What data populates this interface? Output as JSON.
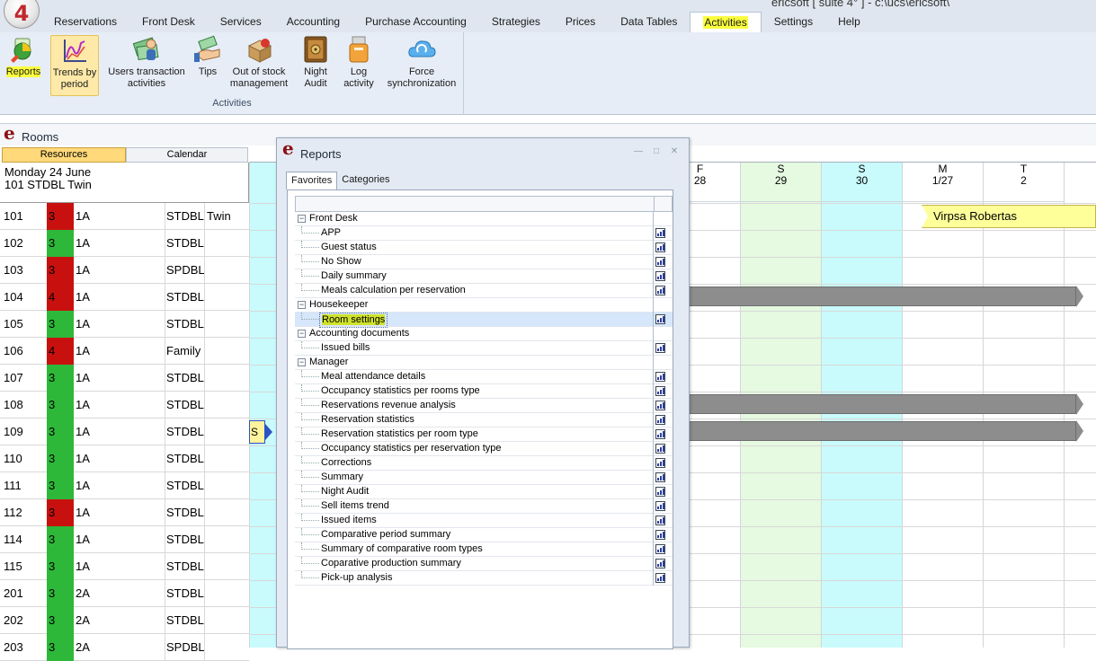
{
  "window": {
    "title": "ericsoft [ suite 4° ] - c:\\ucs\\ericsoft\\",
    "logo_text": "4"
  },
  "menu": {
    "tabs": [
      "Reservations",
      "Front Desk",
      "Services",
      "Accounting",
      "Purchase Accounting",
      "Strategies",
      "Prices",
      "Data Tables",
      "Activities",
      "Settings",
      "Help"
    ],
    "active": "Activities"
  },
  "ribbon": {
    "group_label": "Activities",
    "buttons": {
      "reports": {
        "line1": "Reports",
        "line2": "",
        "icon": "reports-icon"
      },
      "trends": {
        "line1": "Trends by",
        "line2": "period",
        "icon": "chart-icon"
      },
      "users_tx": {
        "line1": "Users transaction",
        "line2": "activities",
        "icon": "money-user-icon"
      },
      "tips": {
        "line1": "Tips",
        "line2": "",
        "icon": "tips-hand-icon"
      },
      "stock": {
        "line1": "Out of stock",
        "line2": "management",
        "icon": "boxes-icon"
      },
      "night_audit": {
        "line1": "Night",
        "line2": "Audit",
        "icon": "safe-icon"
      },
      "log": {
        "line1": "Log",
        "line2": "activity",
        "icon": "usb-icon"
      },
      "sync": {
        "line1": "Force",
        "line2": "synchronization",
        "icon": "cloud-icon"
      }
    }
  },
  "rooms_panel": {
    "title": "Rooms",
    "tabs": {
      "resources": "Resources",
      "calendar": "Calendar"
    },
    "selected_date": "Monday 24 June",
    "selected_room": "101 STDBL Twin",
    "rows": [
      {
        "num": "101",
        "status": "3",
        "color": "red",
        "cap": "1A",
        "type": "STDBL",
        "extra": "Twin"
      },
      {
        "num": "102",
        "status": "3",
        "color": "green",
        "cap": "1A",
        "type": "STDBL",
        "extra": ""
      },
      {
        "num": "103",
        "status": "3",
        "color": "red",
        "cap": "1A",
        "type": "SPDBL",
        "extra": ""
      },
      {
        "num": "104",
        "status": "4",
        "color": "red",
        "cap": "1A",
        "type": "STDBL",
        "extra": ""
      },
      {
        "num": "105",
        "status": "3",
        "color": "green",
        "cap": "1A",
        "type": "STDBL",
        "extra": ""
      },
      {
        "num": "106",
        "status": "4",
        "color": "red",
        "cap": "1A",
        "type": "Family",
        "extra": ""
      },
      {
        "num": "107",
        "status": "3",
        "color": "green",
        "cap": "1A",
        "type": "STDBL",
        "extra": ""
      },
      {
        "num": "108",
        "status": "3",
        "color": "green",
        "cap": "1A",
        "type": "STDBL",
        "extra": ""
      },
      {
        "num": "109",
        "status": "3",
        "color": "green",
        "cap": "1A",
        "type": "STDBL",
        "extra": ""
      },
      {
        "num": "110",
        "status": "3",
        "color": "green",
        "cap": "1A",
        "type": "STDBL",
        "extra": ""
      },
      {
        "num": "111",
        "status": "3",
        "color": "green",
        "cap": "1A",
        "type": "STDBL",
        "extra": ""
      },
      {
        "num": "112",
        "status": "3",
        "color": "red",
        "cap": "1A",
        "type": "STDBL",
        "extra": ""
      },
      {
        "num": "114",
        "status": "3",
        "color": "green",
        "cap": "1A",
        "type": "STDBL",
        "extra": ""
      },
      {
        "num": "115",
        "status": "3",
        "color": "green",
        "cap": "1A",
        "type": "STDBL",
        "extra": ""
      },
      {
        "num": "201",
        "status": "3",
        "color": "green",
        "cap": "2A",
        "type": "STDBL",
        "extra": ""
      },
      {
        "num": "202",
        "status": "3",
        "color": "green",
        "cap": "2A",
        "type": "STDBL",
        "extra": ""
      },
      {
        "num": "203",
        "status": "3",
        "color": "green",
        "cap": "2A",
        "type": "SPDBL",
        "extra": ""
      }
    ]
  },
  "calendar": {
    "days": [
      {
        "dow": "F",
        "date": "28",
        "shade": "white"
      },
      {
        "dow": "S",
        "date": "29",
        "shade": "green"
      },
      {
        "dow": "S",
        "date": "30",
        "shade": "cyan"
      },
      {
        "dow": "M",
        "date": "1/27",
        "shade": "white"
      },
      {
        "dow": "T",
        "date": "2",
        "shade": "white"
      }
    ],
    "guest_booking": "Virpsa Robertas",
    "marker_text": "S"
  },
  "reports_window": {
    "title": "Reports",
    "tabs": [
      "Favorites",
      "Categories"
    ],
    "active_tab": "Favorites",
    "tree": [
      {
        "kind": "cat",
        "label": "Front Desk"
      },
      {
        "kind": "item",
        "label": "APP"
      },
      {
        "kind": "item",
        "label": "Guest status"
      },
      {
        "kind": "item",
        "label": "No Show"
      },
      {
        "kind": "item",
        "label": "Daily summary"
      },
      {
        "kind": "item",
        "label": "Meals calculation per reservation"
      },
      {
        "kind": "cat",
        "label": "Housekeeper"
      },
      {
        "kind": "item",
        "label": "Room settings",
        "selected": true
      },
      {
        "kind": "cat",
        "label": "Accounting documents"
      },
      {
        "kind": "item",
        "label": "Issued bills"
      },
      {
        "kind": "cat",
        "label": "Manager"
      },
      {
        "kind": "item",
        "label": "Meal attendance details"
      },
      {
        "kind": "item",
        "label": "Occupancy statistics per rooms type"
      },
      {
        "kind": "item",
        "label": "Reservations revenue analysis"
      },
      {
        "kind": "item",
        "label": "Reservation statistics"
      },
      {
        "kind": "item",
        "label": "Reservation statistics per room type"
      },
      {
        "kind": "item",
        "label": "Occupancy statistics  per  reservation type"
      },
      {
        "kind": "item",
        "label": "Corrections"
      },
      {
        "kind": "item",
        "label": "Summary"
      },
      {
        "kind": "item",
        "label": "Night Audit"
      },
      {
        "kind": "item",
        "label": "Sell items trend"
      },
      {
        "kind": "item",
        "label": "Issued items"
      },
      {
        "kind": "item",
        "label": "Comparative period summary"
      },
      {
        "kind": "item",
        "label": "Summary of comparative room types"
      },
      {
        "kind": "item",
        "label": "Coparative production summary"
      },
      {
        "kind": "item",
        "label": "Pick-up analysis"
      }
    ]
  },
  "colors": {
    "status_red": "#c8110f",
    "status_green": "#2db83a",
    "highlight_yellow": "#fcff3d",
    "calendar_green": "#e5fae0",
    "calendar_cyan": "#c9fbfc",
    "booking_grey": "#8d8d8d"
  }
}
